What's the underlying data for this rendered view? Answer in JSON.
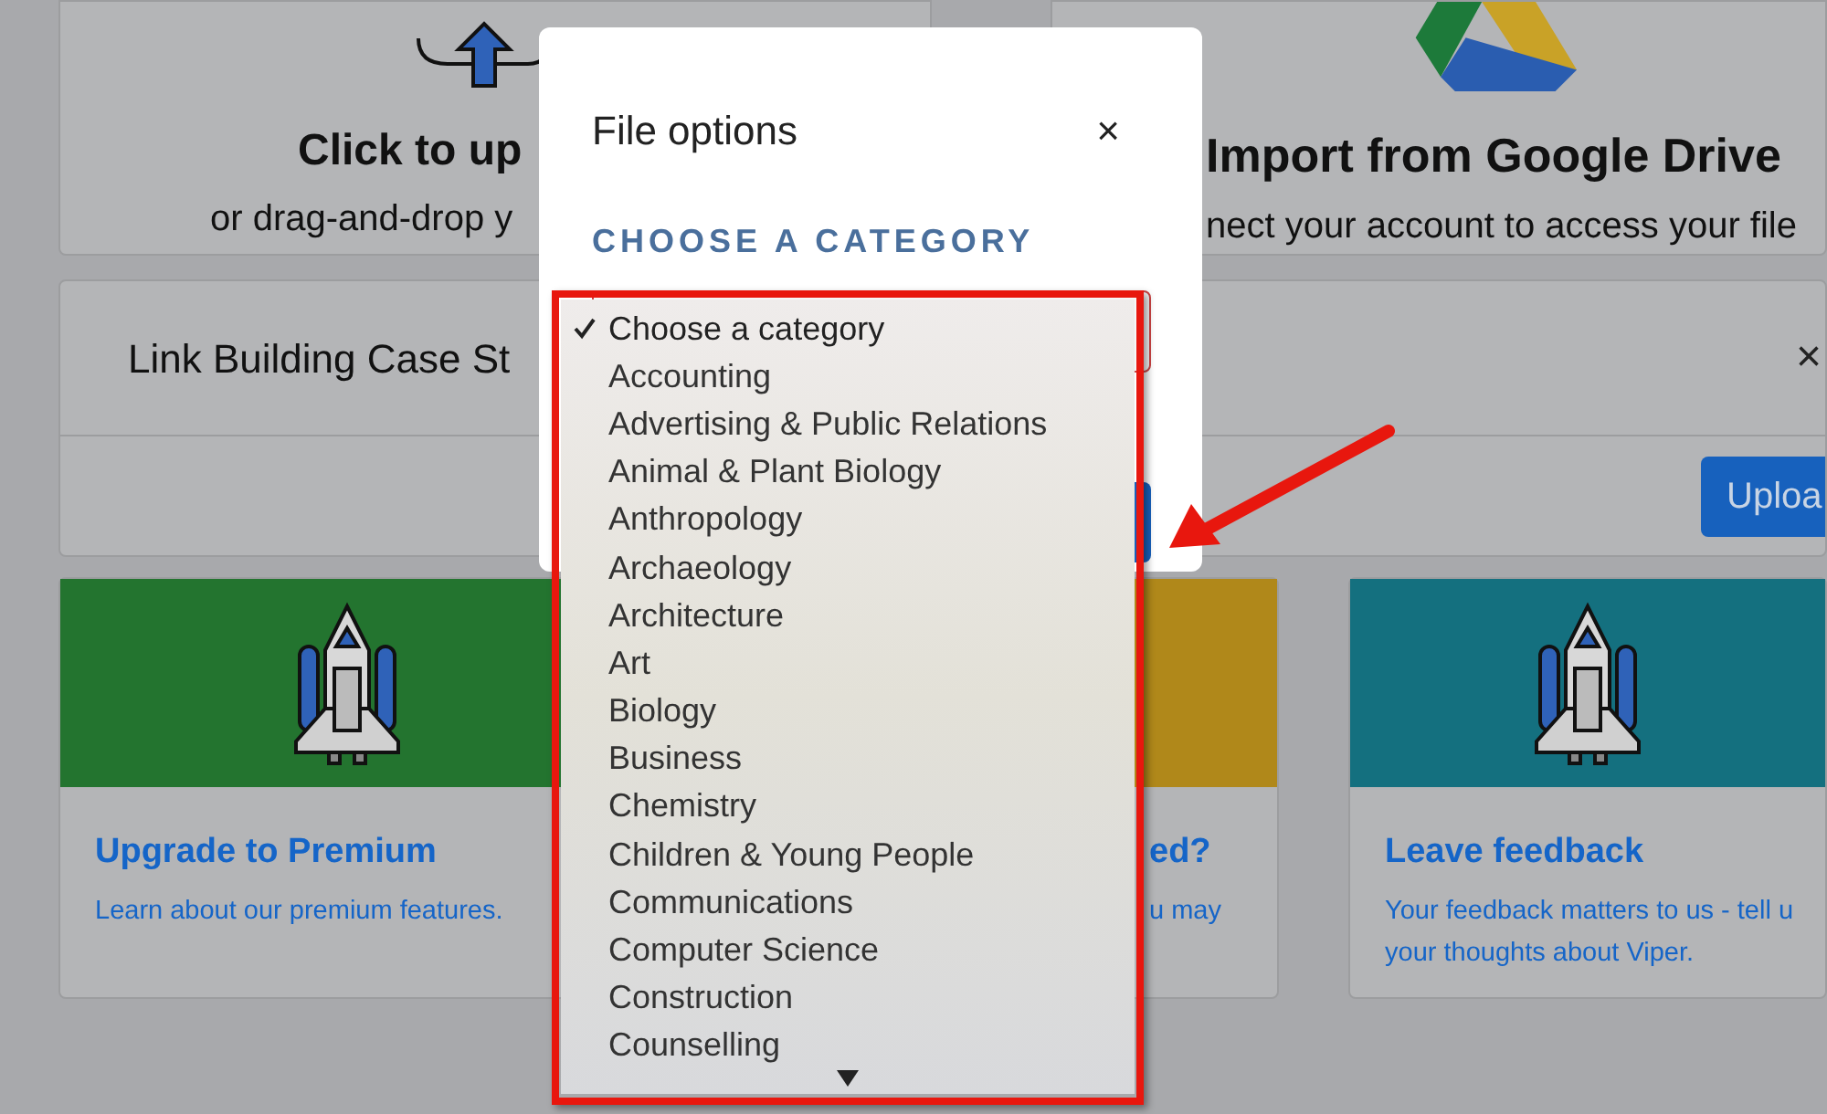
{
  "upload_card": {
    "title": "Click to up",
    "subtitle": "or drag-and-drop y"
  },
  "drive_card": {
    "title": "Import from Google Drive",
    "subtitle": "nect your account to access your file"
  },
  "file_row": {
    "name": "Link Building Case St",
    "close": "×",
    "upload_button": "Uploa"
  },
  "cards": [
    {
      "title": "Upgrade to Premium",
      "text": [
        "Learn about our premium features."
      ],
      "color": "#23742f"
    },
    {
      "title": "ed?",
      "text": [
        "u may"
      ],
      "color": "#b0881a"
    },
    {
      "title": "Leave feedback",
      "text": [
        "Your feedback matters to us - tell u",
        "your thoughts about Viper."
      ],
      "color": "#14707f"
    }
  ],
  "modal": {
    "title": "File options",
    "close": "×",
    "heading": "CHOOSE A CATEGORY"
  },
  "dropdown": {
    "options": [
      {
        "label": "Choose a category",
        "selected": true
      },
      {
        "label": "Accounting",
        "selected": false
      },
      {
        "label": "Advertising & Public Relations",
        "selected": false
      },
      {
        "label": "Animal & Plant Biology",
        "selected": false
      },
      {
        "label": "Anthropology",
        "selected": false
      },
      {
        "label": "Archaeology",
        "selected": false
      },
      {
        "label": "Architecture",
        "selected": false
      },
      {
        "label": "Art",
        "selected": false
      },
      {
        "label": "Biology",
        "selected": false
      },
      {
        "label": "Business",
        "selected": false
      },
      {
        "label": "Chemistry",
        "selected": false
      },
      {
        "label": "Children & Young People",
        "selected": false
      },
      {
        "label": "Communications",
        "selected": false
      },
      {
        "label": "Computer Science",
        "selected": false
      },
      {
        "label": "Construction",
        "selected": false
      },
      {
        "label": "Counselling",
        "selected": false
      }
    ]
  }
}
